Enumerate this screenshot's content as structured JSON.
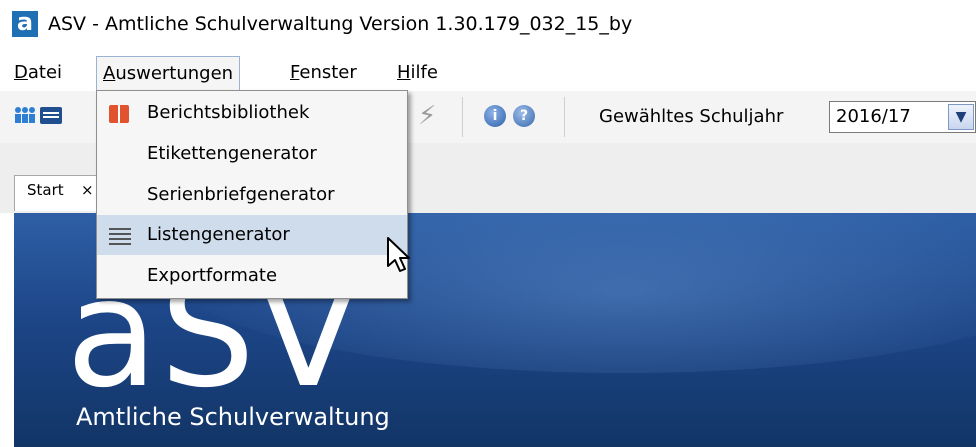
{
  "window": {
    "title": "ASV - Amtliche Schulverwaltung Version 1.30.179_032_15_by",
    "icon": "app-logo-icon",
    "icon_letter": "a"
  },
  "menubar": {
    "items": [
      {
        "label": "Datei",
        "mnemonic": "D"
      },
      {
        "label": "Auswertungen",
        "mnemonic": "A"
      },
      {
        "label": "Fenster",
        "mnemonic": "F"
      },
      {
        "label": "Hilfe",
        "mnemonic": "H"
      }
    ]
  },
  "toolbar": {
    "icons": [
      "people-icon",
      "card-icon",
      "bolt-icon",
      "info-icon",
      "help-icon"
    ],
    "info_glyph": "i",
    "help_glyph": "?",
    "schuljahr_label": "Gewähltes Schuljahr",
    "schuljahr_value": "2016/17"
  },
  "tabs": [
    {
      "label": "Start",
      "close": "×"
    }
  ],
  "dropdown": {
    "items": [
      {
        "label": "Berichtsbibliothek",
        "icon": "book-icon"
      },
      {
        "label": "Etikettengenerator"
      },
      {
        "label": "Serienbriefgenerator"
      },
      {
        "label": "Listengenerator",
        "icon": "list-icon",
        "highlighted": true
      },
      {
        "label": "Exportformate"
      }
    ]
  },
  "banner": {
    "logo": "aSV",
    "subtitle": "Amtliche Schulverwaltung"
  },
  "colors": {
    "brand_blue": "#1f6fb5",
    "banner_top": "#2f5fa6",
    "banner_bottom": "#123566",
    "highlight": "#cfdcec",
    "book_icon": "#e0532e"
  }
}
